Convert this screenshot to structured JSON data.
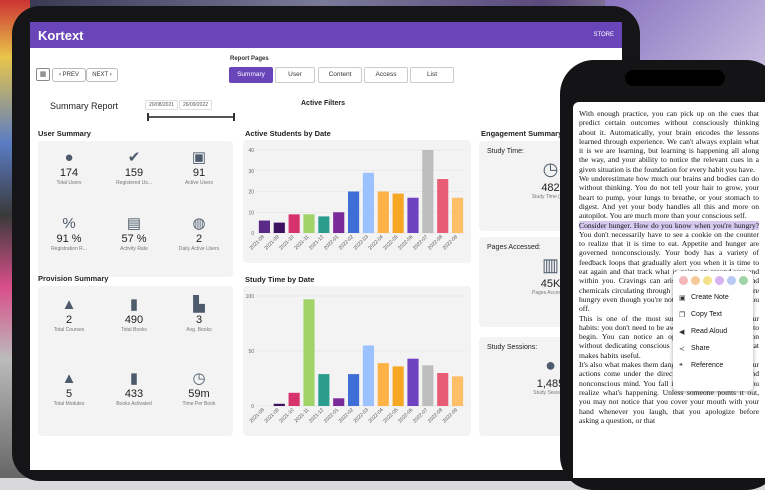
{
  "app": {
    "brand": "Kortext",
    "store": "STORE"
  },
  "nav": {
    "prev": "‹ PREV",
    "next": "NEXT ›",
    "report_pages_label": "Report Pages",
    "tabs": [
      "Summary",
      "User",
      "Content",
      "Access",
      "List"
    ],
    "active_tab": "Summary"
  },
  "summary": {
    "title": "Summary Report",
    "date_from": "20/08/2021",
    "date_to": "26/09/2022",
    "active_filters": "Active Filters"
  },
  "user_summary": {
    "title": "User Summary",
    "stats": [
      {
        "icon": "user-icon",
        "value": "174",
        "label": "Total Users"
      },
      {
        "icon": "user-check-icon",
        "value": "159",
        "label": "Registered Us..."
      },
      {
        "icon": "user-laptop-icon",
        "value": "91",
        "label": "Active Users"
      },
      {
        "icon": "user-percent-icon",
        "value": "91 %",
        "label": "Registration R..."
      },
      {
        "icon": "activity-rate-icon",
        "value": "57 %",
        "label": "Activity Rate"
      },
      {
        "icon": "daily-active-icon",
        "value": "2",
        "label": "Daily Active Users"
      }
    ]
  },
  "provision_summary": {
    "title": "Provision Summary",
    "stats": [
      {
        "icon": "graduation-cap-icon",
        "value": "2",
        "label": "Total Courses"
      },
      {
        "icon": "book-icon",
        "value": "490",
        "label": "Total Books"
      },
      {
        "icon": "avg-books-icon",
        "value": "3",
        "label": "Avg. Books"
      },
      {
        "icon": "modules-icon",
        "value": "5",
        "label": "Total Modules"
      },
      {
        "icon": "book-activated-icon",
        "value": "433",
        "label": "Books Activated"
      },
      {
        "icon": "book-clock-icon",
        "value": "59m",
        "label": "Time Per Book"
      }
    ]
  },
  "chart_data": [
    {
      "type": "bar",
      "title": "Active Students by Date",
      "categories": [
        "2021-08",
        "2021-09",
        "2021-10",
        "2021-11",
        "2021-12",
        "2022-01",
        "2022-02",
        "2022-03",
        "2022-04",
        "2022-05",
        "2022-06",
        "2022-07",
        "2022-08",
        "2022-09"
      ],
      "values": [
        6,
        5,
        9,
        9,
        8,
        10,
        20,
        29,
        20,
        19,
        17,
        40,
        26,
        17
      ],
      "colors": [
        "#5b2a86",
        "#3b1160",
        "#d6336c",
        "#a0d468",
        "#2a9d8f",
        "#7b2a9b",
        "#3f6fd6",
        "#9bc1ff",
        "#ffb347",
        "#f5a623",
        "#6f42c1",
        "#bdbdbd",
        "#e85d75",
        "#ffbf69"
      ],
      "yticks": [
        0,
        10,
        20,
        30,
        40
      ],
      "ylim": [
        0,
        40
      ]
    },
    {
      "type": "bar",
      "title": "Study Time by Date",
      "categories": [
        "2021-08",
        "2021-09",
        "2021-10",
        "2021-11",
        "2021-12",
        "2022-01",
        "2022-02",
        "2022-03",
        "2022-04",
        "2022-05",
        "2022-06",
        "2022-07",
        "2022-08",
        "2022-09"
      ],
      "values": [
        0,
        2,
        12,
        97,
        29,
        7,
        29,
        55,
        39,
        36,
        43,
        37,
        30,
        27
      ],
      "colors": [
        "#5b2a86",
        "#3b1160",
        "#d6336c",
        "#a0d468",
        "#2a9d8f",
        "#7b2a9b",
        "#3f6fd6",
        "#9bc1ff",
        "#ffb347",
        "#f5a623",
        "#6f42c1",
        "#bdbdbd",
        "#e85d75",
        "#ffbf69"
      ],
      "yticks": [
        0,
        50,
        100
      ],
      "ylim": [
        0,
        100
      ]
    }
  ],
  "engagement": {
    "title": "Engagement Summary",
    "cards": [
      {
        "title": "Study Time:",
        "icon": "clock-icon",
        "value": "482",
        "label": "Study Time (Hrs)"
      },
      {
        "title": "Pages Accessed:",
        "icon": "open-book-icon",
        "value": "45K",
        "label": "Pages Accessed"
      },
      {
        "title": "Study Sessions:",
        "icon": "session-user-icon",
        "value": "1,485",
        "label": "Study Sessions"
      }
    ]
  },
  "ebook": {
    "p1": "With enough practice, you can pick up on the cues that predict certain outcomes without consciously thinking about it. Automatically, your brain encodes the lessons learned through experience. We can't always explain what it is we are learning, but learning is happening all along the way, and your ability to notice the relevant cues in a given situation is the foundation for every habit you have.",
    "p2": "We underestimate how much our brains and bodies can do without thinking. You do not tell your hair to grow, your heart to pump, your lungs to breathe, or your stomach to digest. And yet your body handles all this and more on autopilot. You are much more than your conscious self.",
    "p3_hl": "Consider hunger. How do you know when you're hungry?",
    "p3": "You don't necessarily have to see a cookie on the counter to realize that it is time to eat. Appetite and hunger are governed nonconsciously. Your body has a variety of feedback loops that gradually alert you when it is time to eat again and that track what is going on around you and within you. Cravings can arise thanks to hormones and chemicals circulating through your body. Suddenly, you're hungry even though you're not quite sure what tipped you off.",
    "p4": "This is one of the most surprising insights about our habits: you don't need to be aware of the cue for a habit to begin. You can notice an opportunity and take action without dedicating conscious attention to it. This is what makes habits useful.",
    "p5": "It's also what makes them dangerous. As habits form, your actions come under the direction of your automatic and nonconscious mind. You fall into old patterns before you realize what's happening. Unless someone points it out, you may not notice that you cover your mouth with your hand whenever you laugh, that you apologize before asking a question, or that"
  },
  "popup": {
    "colors": [
      "#f4b8b8",
      "#f7c89a",
      "#f4e28a",
      "#d7b3f0",
      "#b8c9f4",
      "#9fd5a6"
    ],
    "items": [
      {
        "icon": "note-icon",
        "label": "Create Note"
      },
      {
        "icon": "copy-icon",
        "label": "Copy Text"
      },
      {
        "icon": "speaker-icon",
        "label": "Read Aloud"
      },
      {
        "icon": "share-icon",
        "label": "Share"
      },
      {
        "icon": "reference-icon",
        "label": "Reference"
      }
    ]
  }
}
